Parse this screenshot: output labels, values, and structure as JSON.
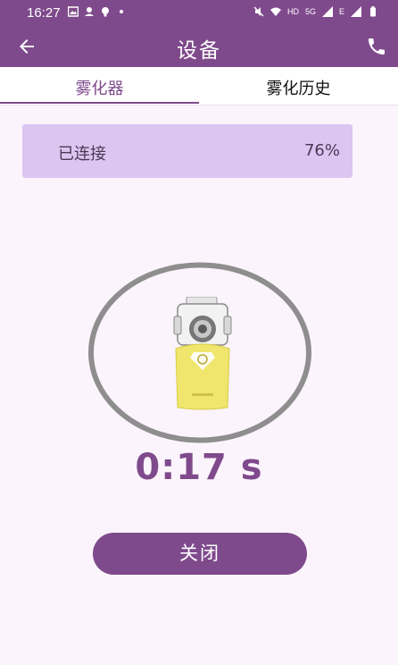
{
  "status_bar": {
    "time": "16:27",
    "left_icons": [
      "image-icon",
      "notification-icon",
      "bulb-icon",
      "dot-icon"
    ],
    "right_icons": [
      "mute-icon",
      "wifi-icon",
      "hd-icon",
      "signal-5g-icon",
      "signal-icon",
      "battery-icon"
    ],
    "hd_text": "HD",
    "net_5g": "5G",
    "net_e": "E"
  },
  "app_bar": {
    "title": "设备",
    "back_icon": "arrow-left-icon",
    "phone_icon": "phone-icon"
  },
  "tabs": [
    {
      "label": "雾化器",
      "selected": true
    },
    {
      "label": "雾化历史",
      "selected": false
    }
  ],
  "connection": {
    "status": "已连接",
    "battery_percent": "76%"
  },
  "progress_ring": {
    "progress_fraction": 0.04,
    "track_color": "#8e8e8e",
    "progress_color": "#7f4a8c"
  },
  "timer": {
    "text": "0:17 s"
  },
  "close_button": {
    "label": "关闭"
  },
  "colors": {
    "primary": "#7f4a8c",
    "card": "#dcc5f1",
    "background": "#fbf4fc"
  }
}
